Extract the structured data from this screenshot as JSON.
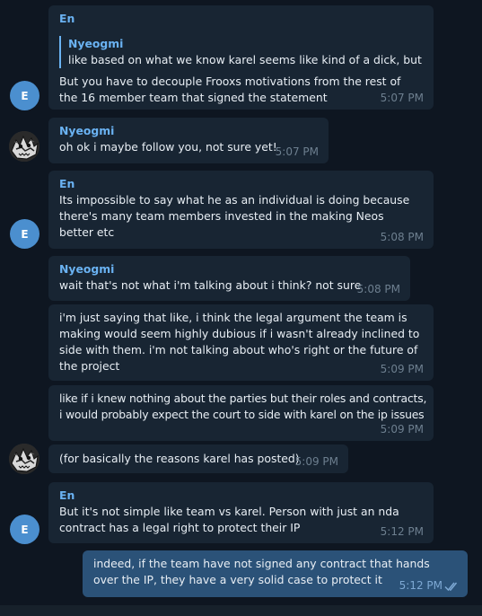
{
  "messages": [
    {
      "sender": "En",
      "reply_to": {
        "name": "Nyeogmi",
        "text": "like based on what we know karel seems like kind of a dick, but i'..."
      },
      "text": "But you have to decouple Frooxs motivations from the rest of the 16 member team that signed the statement",
      "time": "5:07 PM"
    },
    {
      "sender": "Nyeogmi",
      "text": "oh ok i maybe follow you, not sure yet!",
      "time": "5:07 PM"
    },
    {
      "sender": "En",
      "text": "Its impossible to say what he as an individual is doing because there's many team members invested in the making Neos better etc",
      "time": "5:08 PM"
    },
    {
      "sender": "Nyeogmi",
      "text": "wait that's not what i'm talking about i think? not sure",
      "time": "5:08 PM"
    },
    {
      "text": "i'm just saying that like, i think the legal argument the team is making would seem highly dubious if i wasn't already inclined to side with them. i'm not talking about who's right or the future of the project",
      "time": "5:09 PM"
    },
    {
      "text": "like if i knew nothing about the parties but their roles and contracts, i would probably expect the court to side with karel on the ip issues",
      "time": "5:09 PM"
    },
    {
      "text": "(for basically the reasons karel has posted)",
      "time": "5:09 PM"
    },
    {
      "sender": "En",
      "text": "But it's not simple like team vs karel. Person with just an nda contract has a legal right to protect their IP",
      "time": "5:12 PM"
    },
    {
      "text": "indeed, if the team have not signed any contract that hands over the IP, they have a very solid case to protect it",
      "time": "5:12 PM"
    }
  ],
  "avatars": {
    "en_initial": "E"
  },
  "colors": {
    "background": "#0e1621",
    "incoming_bubble": "#182533",
    "outgoing_bubble": "#2b5278",
    "sender_name": "#6ab2f2",
    "avatar_en": "#4b8fcf",
    "read_checks": "#7da8d3"
  },
  "icons": {
    "read_status": "double-check-icon",
    "nyeogmi_avatar": "illustrated-creature-avatar"
  }
}
